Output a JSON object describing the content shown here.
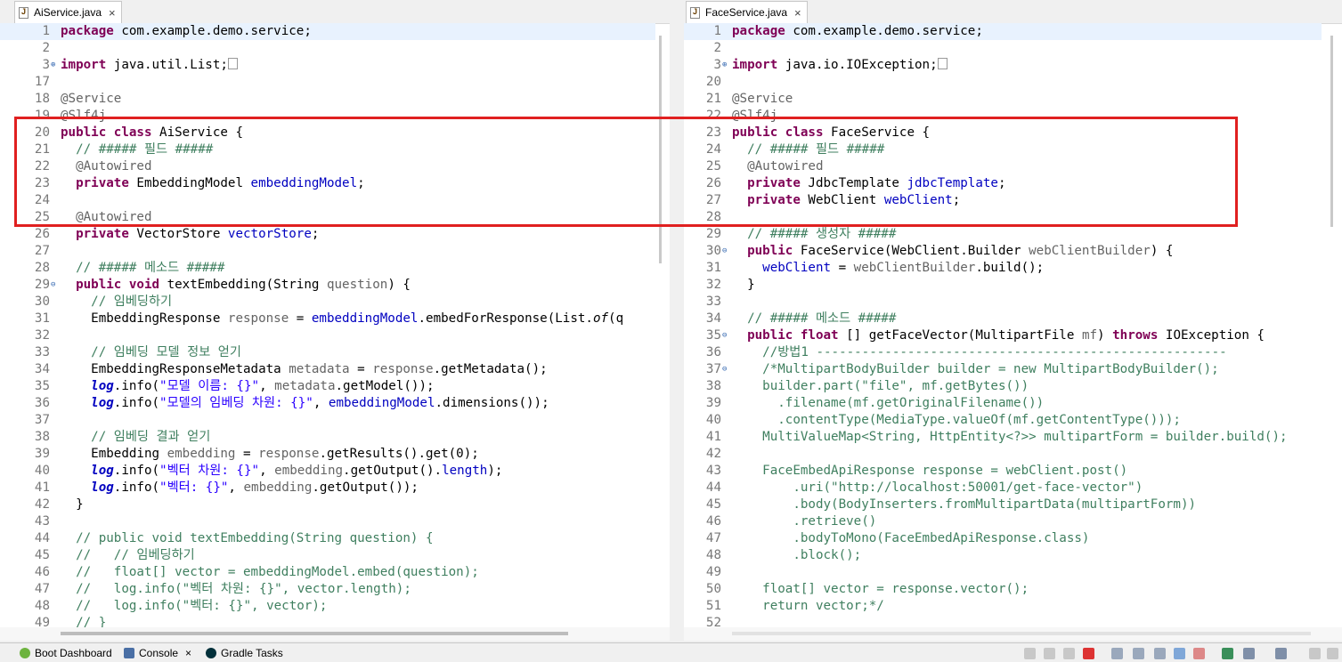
{
  "left_editor": {
    "tab_label": "AiService.java",
    "lines": [
      {
        "n": "1",
        "segs": [
          [
            "kw",
            "package"
          ],
          [
            "",
            "com.example.demo.service;"
          ]
        ],
        "current": true
      },
      {
        "n": "2",
        "segs": []
      },
      {
        "n": "3",
        "fold": "⊕",
        "segs": [
          [
            "kw",
            "import"
          ],
          [
            "",
            "java.util.List;"
          ],
          [
            "box",
            ""
          ]
        ]
      },
      {
        "n": "17",
        "segs": []
      },
      {
        "n": "18",
        "segs": [
          [
            "ann",
            "@Service"
          ]
        ]
      },
      {
        "n": "19",
        "segs": [
          [
            "ann",
            "@Slf4j"
          ]
        ]
      },
      {
        "n": "20",
        "segs": [
          [
            "kw",
            "public class"
          ],
          [
            "",
            "AiService {"
          ]
        ]
      },
      {
        "n": "21",
        "segs": [
          [
            "cm",
            "  // ##### 필드 #####"
          ]
        ]
      },
      {
        "n": "22",
        "segs": [
          [
            "ann",
            "  @Autowired"
          ]
        ]
      },
      {
        "n": "23",
        "segs": [
          [
            "kw",
            "  private"
          ],
          [
            "",
            "EmbeddingModel "
          ],
          [
            "fld",
            "embeddingModel"
          ],
          [
            "",
            ";"
          ]
        ]
      },
      {
        "n": "24",
        "segs": []
      },
      {
        "n": "25",
        "segs": [
          [
            "ann",
            "  @Autowired"
          ]
        ]
      },
      {
        "n": "26",
        "segs": [
          [
            "kw",
            "  private"
          ],
          [
            "",
            "VectorStore "
          ],
          [
            "fld",
            "vectorStore"
          ],
          [
            "",
            ";"
          ]
        ]
      },
      {
        "n": "27",
        "segs": []
      },
      {
        "n": "28",
        "segs": [
          [
            "cm",
            "  // ##### 메소드 #####"
          ]
        ]
      },
      {
        "n": "29",
        "fold": "⊖",
        "segs": [
          [
            "kw",
            "  public void"
          ],
          [
            "",
            "textEmbedding(String "
          ],
          [
            "ann",
            "question"
          ],
          [
            "",
            ") {"
          ]
        ]
      },
      {
        "n": "30",
        "segs": [
          [
            "cm",
            "    // 임베딩하기"
          ]
        ]
      },
      {
        "n": "31",
        "segs": [
          [
            "",
            "    EmbeddingResponse "
          ],
          [
            "ann",
            "response"
          ],
          [
            "",
            " = "
          ],
          [
            "fld",
            "embeddingModel"
          ],
          [
            "",
            ".embedForResponse(List."
          ],
          [
            "it",
            "of"
          ],
          [
            "",
            "(q"
          ]
        ]
      },
      {
        "n": "32",
        "segs": []
      },
      {
        "n": "33",
        "segs": [
          [
            "cm",
            "    // 임베딩 모델 정보 얻기"
          ]
        ]
      },
      {
        "n": "34",
        "segs": [
          [
            "",
            "    EmbeddingResponseMetadata "
          ],
          [
            "ann",
            "metadata"
          ],
          [
            "",
            " = "
          ],
          [
            "ann",
            "response"
          ],
          [
            "",
            ".getMetadata();"
          ]
        ]
      },
      {
        "n": "35",
        "segs": [
          [
            "slog",
            "    log"
          ],
          [
            "",
            ".info("
          ],
          [
            "str",
            "\"모델 이름: {}\""
          ],
          [
            "",
            ", "
          ],
          [
            "ann",
            "metadata"
          ],
          [
            "",
            ".getModel());"
          ]
        ]
      },
      {
        "n": "36",
        "segs": [
          [
            "slog",
            "    log"
          ],
          [
            "",
            ".info("
          ],
          [
            "str",
            "\"모델의 임베딩 차원: {}\""
          ],
          [
            "",
            ", "
          ],
          [
            "fld",
            "embeddingModel"
          ],
          [
            "",
            ".dimensions());"
          ]
        ]
      },
      {
        "n": "37",
        "segs": []
      },
      {
        "n": "38",
        "segs": [
          [
            "cm",
            "    // 임베딩 결과 얻기"
          ]
        ]
      },
      {
        "n": "39",
        "segs": [
          [
            "",
            "    Embedding "
          ],
          [
            "ann",
            "embedding"
          ],
          [
            "",
            " = "
          ],
          [
            "ann",
            "response"
          ],
          [
            "",
            ".getResults().get(0);"
          ]
        ]
      },
      {
        "n": "40",
        "segs": [
          [
            "slog",
            "    log"
          ],
          [
            "",
            ".info("
          ],
          [
            "str",
            "\"벡터 차원: {}\""
          ],
          [
            "",
            ", "
          ],
          [
            "ann",
            "embedding"
          ],
          [
            "",
            ".getOutput()."
          ],
          [
            "fld",
            "length"
          ],
          [
            "",
            ");"
          ]
        ]
      },
      {
        "n": "41",
        "segs": [
          [
            "slog",
            "    log"
          ],
          [
            "",
            ".info("
          ],
          [
            "str",
            "\"벡터: {}\""
          ],
          [
            "",
            ", "
          ],
          [
            "ann",
            "embedding"
          ],
          [
            "",
            ".getOutput());"
          ]
        ]
      },
      {
        "n": "42",
        "segs": [
          [
            "",
            "  }"
          ]
        ]
      },
      {
        "n": "43",
        "segs": []
      },
      {
        "n": "44",
        "segs": [
          [
            "cm",
            "  // public void textEmbedding(String question) {"
          ]
        ]
      },
      {
        "n": "45",
        "segs": [
          [
            "cm",
            "  //   // 임베딩하기"
          ]
        ]
      },
      {
        "n": "46",
        "segs": [
          [
            "cm",
            "  //   float[] vector = embeddingModel.embed(question);"
          ]
        ]
      },
      {
        "n": "47",
        "segs": [
          [
            "cm",
            "  //   log.info(\"벡터 차원: {}\", vector.length);"
          ]
        ]
      },
      {
        "n": "48",
        "segs": [
          [
            "cm",
            "  //   log.info(\"벡터: {}\", vector);"
          ]
        ]
      },
      {
        "n": "49",
        "segs": [
          [
            "cm",
            "  // }"
          ]
        ]
      }
    ]
  },
  "right_editor": {
    "tab_label": "FaceService.java",
    "lines": [
      {
        "n": "1",
        "segs": [
          [
            "kw",
            "package"
          ],
          [
            "",
            "com.example.demo.service;"
          ]
        ],
        "current": true
      },
      {
        "n": "2",
        "segs": []
      },
      {
        "n": "3",
        "fold": "⊕",
        "segs": [
          [
            "kw",
            "import"
          ],
          [
            "",
            "java.io.IOException;"
          ],
          [
            "box",
            ""
          ]
        ]
      },
      {
        "n": "20",
        "segs": []
      },
      {
        "n": "21",
        "segs": [
          [
            "ann",
            "@Service"
          ]
        ]
      },
      {
        "n": "22",
        "segs": [
          [
            "ann",
            "@Slf4j"
          ]
        ]
      },
      {
        "n": "23",
        "segs": [
          [
            "kw",
            "public class"
          ],
          [
            "",
            "FaceService {"
          ]
        ]
      },
      {
        "n": "24",
        "segs": [
          [
            "cm",
            "  // ##### 필드 #####"
          ]
        ]
      },
      {
        "n": "25",
        "segs": [
          [
            "ann",
            "  @Autowired"
          ]
        ]
      },
      {
        "n": "26",
        "segs": [
          [
            "kw",
            "  private"
          ],
          [
            "",
            "JdbcTemplate "
          ],
          [
            "fld",
            "jdbcTemplate"
          ],
          [
            "",
            ";"
          ]
        ]
      },
      {
        "n": "27",
        "segs": [
          [
            "kw",
            "  private"
          ],
          [
            "",
            "WebClient "
          ],
          [
            "fld",
            "webClient"
          ],
          [
            "",
            ";"
          ]
        ]
      },
      {
        "n": "28",
        "segs": []
      },
      {
        "n": "29",
        "segs": [
          [
            "cm",
            "  // ##### 생성자 #####"
          ]
        ]
      },
      {
        "n": "30",
        "fold": "⊖",
        "segs": [
          [
            "kw",
            "  public"
          ],
          [
            "",
            "FaceService(WebClient.Builder "
          ],
          [
            "ann",
            "webClientBuilder"
          ],
          [
            "",
            ") {"
          ]
        ]
      },
      {
        "n": "31",
        "segs": [
          [
            "fld",
            "    webClient"
          ],
          [
            "",
            " = "
          ],
          [
            "ann",
            "webClientBuilder"
          ],
          [
            "",
            ".build();"
          ]
        ]
      },
      {
        "n": "32",
        "segs": [
          [
            "",
            "  }"
          ]
        ]
      },
      {
        "n": "33",
        "segs": []
      },
      {
        "n": "34",
        "segs": [
          [
            "cm",
            "  // ##### 메소드 #####"
          ]
        ]
      },
      {
        "n": "35",
        "fold": "⊖",
        "segs": [
          [
            "kw",
            "  public float"
          ],
          [
            "",
            "[] getFaceVector(MultipartFile "
          ],
          [
            "ann",
            "mf"
          ],
          [
            "",
            ") "
          ],
          [
            "kw",
            "throws"
          ],
          [
            "",
            "IOException {"
          ]
        ]
      },
      {
        "n": "36",
        "segs": [
          [
            "cm",
            "    //방법1 ------------------------------------------------------"
          ]
        ]
      },
      {
        "n": "37",
        "fold": "⊖",
        "segs": [
          [
            "cm",
            "    /*MultipartBodyBuilder builder = new MultipartBodyBuilder();"
          ]
        ]
      },
      {
        "n": "38",
        "segs": [
          [
            "cm",
            "    builder.part(\"file\", mf.getBytes())"
          ]
        ]
      },
      {
        "n": "39",
        "segs": [
          [
            "cm",
            "      .filename(mf.getOriginalFilename())"
          ]
        ]
      },
      {
        "n": "40",
        "segs": [
          [
            "cm",
            "      .contentType(MediaType.valueOf(mf.getContentType()));"
          ]
        ]
      },
      {
        "n": "41",
        "segs": [
          [
            "cm",
            "    MultiValueMap<String, HttpEntity<?>> multipartForm = builder.build();"
          ]
        ]
      },
      {
        "n": "42",
        "segs": []
      },
      {
        "n": "43",
        "segs": [
          [
            "cm",
            "    FaceEmbedApiResponse response = webClient.post()"
          ]
        ]
      },
      {
        "n": "44",
        "segs": [
          [
            "cm",
            "        .uri(\"http://localhost:50001/get-face-vector\")"
          ]
        ]
      },
      {
        "n": "45",
        "segs": [
          [
            "cm",
            "        .body(BodyInserters.fromMultipartData(multipartForm))"
          ]
        ]
      },
      {
        "n": "46",
        "segs": [
          [
            "cm",
            "        .retrieve()"
          ]
        ]
      },
      {
        "n": "47",
        "segs": [
          [
            "cm",
            "        .bodyToMono(FaceEmbedApiResponse.class)"
          ]
        ]
      },
      {
        "n": "48",
        "segs": [
          [
            "cm",
            "        .block();"
          ]
        ]
      },
      {
        "n": "49",
        "segs": []
      },
      {
        "n": "50",
        "segs": [
          [
            "cm",
            "    float[] vector = response.vector();"
          ]
        ]
      },
      {
        "n": "51",
        "segs": [
          [
            "cm",
            "    return vector;*/"
          ]
        ]
      },
      {
        "n": "52",
        "segs": []
      }
    ]
  },
  "bottom_panel": {
    "tabs": [
      {
        "label": "Boot Dashboard",
        "icon": "boot-dashboard-icon",
        "color": "#6db33f"
      },
      {
        "label": "Console",
        "icon": "console-icon",
        "color": "#4a6fa5"
      },
      {
        "label": "Gradle Tasks",
        "icon": "gradle-icon",
        "color": "#02303a"
      }
    ],
    "close_glyph": "×"
  },
  "colors": {
    "highlight": "#e02020",
    "keyword": "#7f0055",
    "comment": "#3f7f5f",
    "field": "#0000c0",
    "string": "#2a00ff"
  }
}
